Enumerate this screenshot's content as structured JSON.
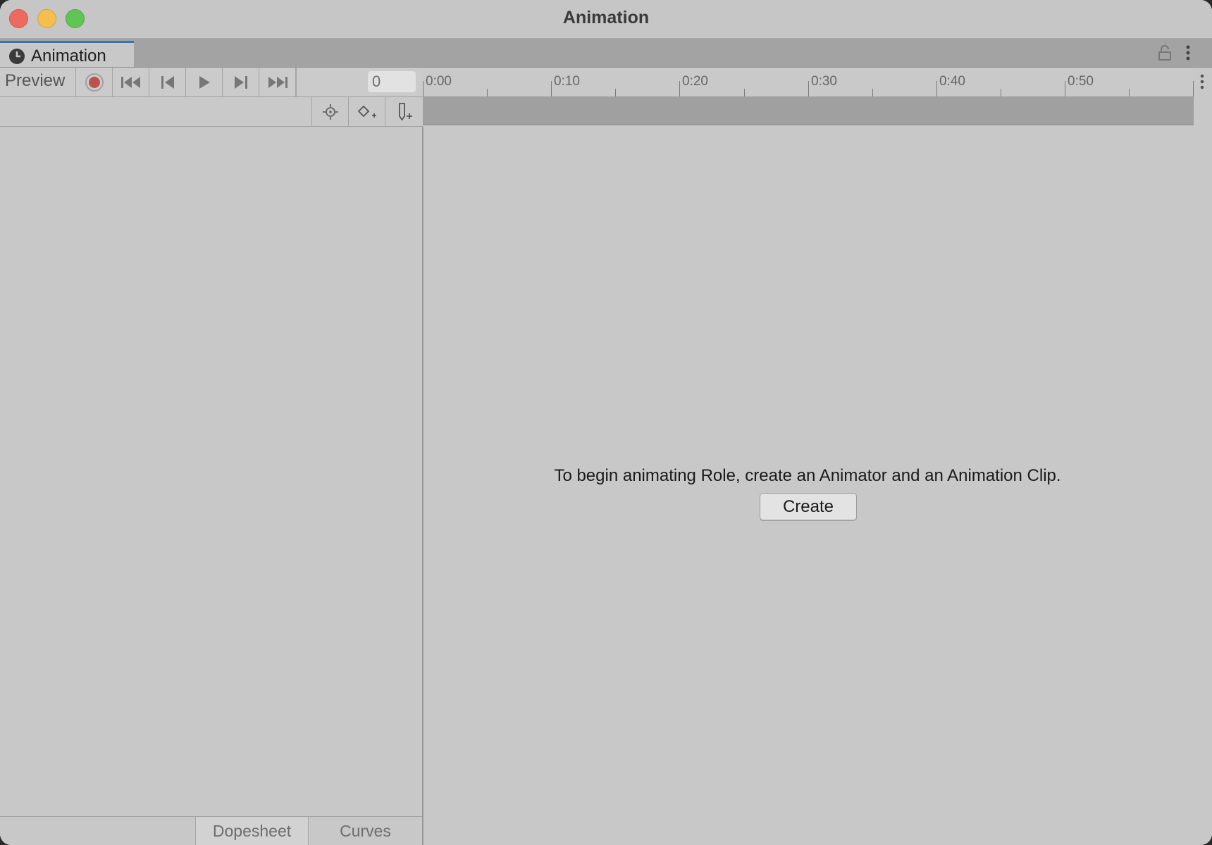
{
  "window": {
    "title": "Animation"
  },
  "tab": {
    "label": "Animation"
  },
  "toolbar": {
    "preview_label": "Preview",
    "frame_value": "0"
  },
  "timeline": {
    "labels": [
      "0:00",
      "0:10",
      "0:20",
      "0:30",
      "0:40",
      "0:50"
    ]
  },
  "main": {
    "message": "To begin animating Role, create an Animator and an Animation Clip.",
    "create_label": "Create"
  },
  "bottom_tabs": {
    "dopesheet": "Dopesheet",
    "curves": "Curves"
  },
  "colors": {
    "tab_accent": "#3a72b8",
    "record": "#c0504d"
  }
}
